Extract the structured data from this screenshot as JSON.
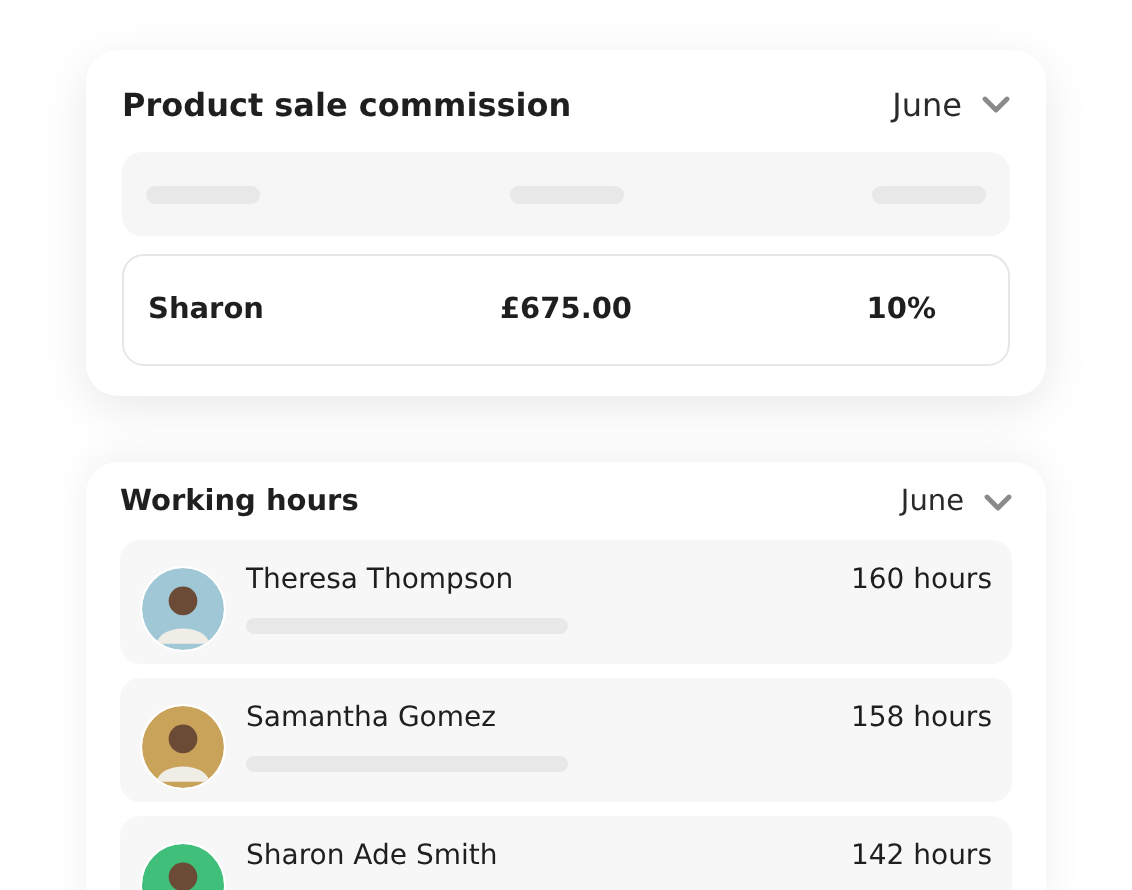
{
  "commission": {
    "title": "Product sale commission",
    "period": "June",
    "row": {
      "name": "Sharon",
      "amount": "£675.00",
      "rate": "10%"
    }
  },
  "working_hours": {
    "title": "Working hours",
    "period": "June",
    "people": [
      {
        "name": "Theresa Thompson",
        "hours": "160 hours"
      },
      {
        "name": "Samantha Gomez",
        "hours": "158 hours"
      },
      {
        "name": "Sharon Ade Smith",
        "hours": "142 hours"
      }
    ]
  }
}
